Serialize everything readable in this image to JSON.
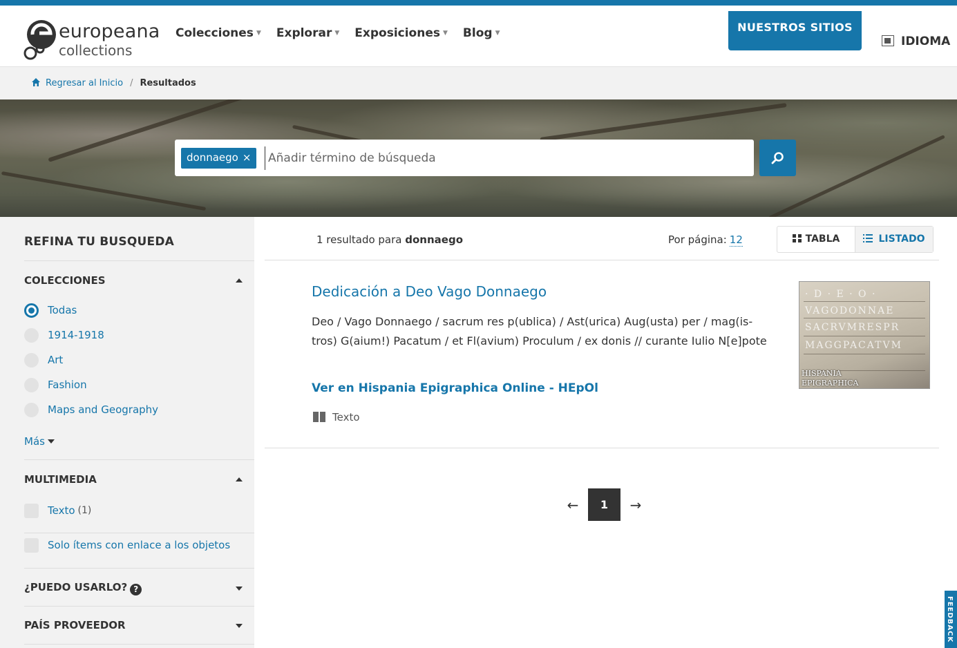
{
  "logo": {
    "line1": "europeana",
    "line2": "collections"
  },
  "nav": [
    {
      "label": "Colecciones"
    },
    {
      "label": "Explorar"
    },
    {
      "label": "Exposiciones"
    },
    {
      "label": "Blog"
    }
  ],
  "header": {
    "sites_button": "NUESTROS SITIOS",
    "language": "IDIOMA"
  },
  "breadcrumb": {
    "home": "Regresar al Inicio",
    "separator": "/",
    "current": "Resultados"
  },
  "search": {
    "tag": "donnaego",
    "tag_remove": "×",
    "placeholder": "Añadir término de búsqueda"
  },
  "sidebar": {
    "title": "REFINA TU BUSQUEDA",
    "collections": {
      "title": "COLECCIONES",
      "options": [
        {
          "label": "Todas",
          "selected": true
        },
        {
          "label": "1914-1918",
          "selected": false
        },
        {
          "label": "Art",
          "selected": false
        },
        {
          "label": "Fashion",
          "selected": false
        },
        {
          "label": "Maps and Geography",
          "selected": false
        }
      ],
      "more": "Más"
    },
    "multimedia": {
      "title": "MULTIMEDIA",
      "options": [
        {
          "label": "Texto",
          "count": "(1)"
        },
        {
          "label": "Solo ítems con enlace a los objetos"
        }
      ]
    },
    "rights": {
      "title": "¿PUEDO USARLO?",
      "help": "?"
    },
    "country": {
      "title": "PAÍS PROVEEDOR"
    }
  },
  "results": {
    "count_text": "1 resultado para",
    "query": "donnaego",
    "per_page_label": "Por página:",
    "per_page": "12",
    "view_table": "TABLA",
    "view_list": "LISTADO",
    "items": [
      {
        "title": "Dedicación a Deo Vago Donnaego",
        "description": "Deo / Vago Donnaego / sacrum res p(ublica) / Ast(urica) Aug(usta) per / mag(is-tros) G(aium!) Pacatum / et Fl(avium) Proculum / ex donis // curante Iulio N[e]pote",
        "link": "Ver en Hispania Epigraphica Online - HEpOl",
        "type": "Texto",
        "thumb_watermark": [
          "HISPANIA",
          "EPIGRAPHICA"
        ]
      }
    ]
  },
  "pagination": {
    "prev": "←",
    "current": "1",
    "next": "→"
  },
  "feedback": "FEEDBACK",
  "colors": {
    "accent": "#1676aa",
    "sidebar_bg": "#f2f2f2"
  }
}
